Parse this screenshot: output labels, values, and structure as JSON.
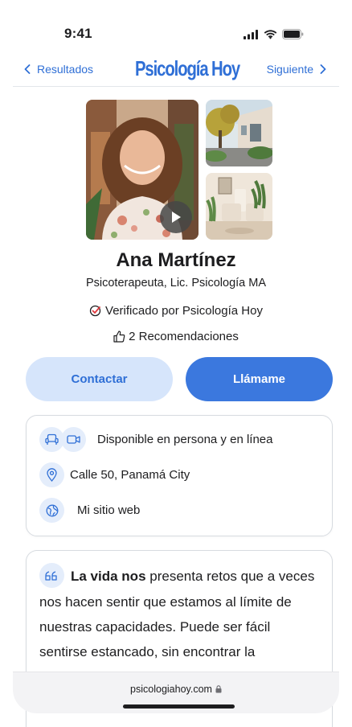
{
  "status": {
    "time": "9:41"
  },
  "nav": {
    "back_label": "Resultados",
    "logo_text": "Psicología Hoy",
    "next_label": "Siguiente"
  },
  "profile": {
    "name": "Ana Martínez",
    "title": "Psicoterapeuta, Lic. Psicología MA",
    "verified_text": "Verificado por Psicología Hoy",
    "recommendations_text": "2 Recomendaciones"
  },
  "actions": {
    "contact_label": "Contactar",
    "call_label": "Llámame"
  },
  "info": {
    "availability": "Disponible en persona y en línea",
    "address": "Calle 50, Panamá City",
    "website": "Mi sitio web"
  },
  "about": {
    "lead": "La vida nos",
    "body": " presenta retos que a veces nos hacen sentir que estamos al límite de nuestras capacidades. Puede ser fácil sentirse estancado, sin encontrar la"
  },
  "browser": {
    "url": "psicologiahoy.com"
  },
  "colors": {
    "accent": "#2f6fd6",
    "primary_button": "#3b78de",
    "secondary_button": "#d6e5fb",
    "icon_bg": "#e4edfb",
    "verified_check": "#e0393e"
  }
}
